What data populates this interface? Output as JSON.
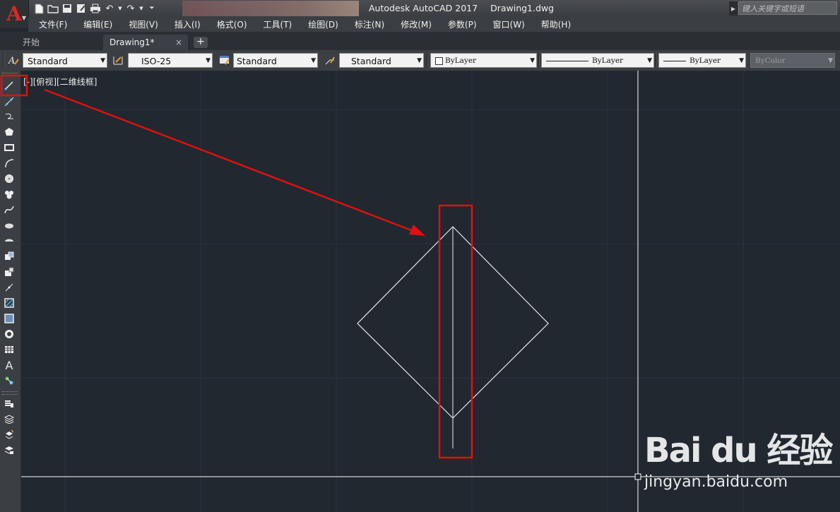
{
  "window": {
    "app_name": "Autodesk AutoCAD 2017",
    "file_name": "Drawing1.dwg",
    "search_placeholder": "键入关键字或短语"
  },
  "menubar": [
    {
      "label": "文件(F)"
    },
    {
      "label": "编辑(E)"
    },
    {
      "label": "视图(V)"
    },
    {
      "label": "插入(I)"
    },
    {
      "label": "格式(O)"
    },
    {
      "label": "工具(T)"
    },
    {
      "label": "绘图(D)"
    },
    {
      "label": "标注(N)"
    },
    {
      "label": "修改(M)"
    },
    {
      "label": "参数(P)"
    },
    {
      "label": "窗口(W)"
    },
    {
      "label": "帮助(H)"
    }
  ],
  "tabs": [
    {
      "label": "开始",
      "active": false
    },
    {
      "label": "Drawing1*",
      "active": true
    }
  ],
  "tab_close": "×",
  "tab_add": "+",
  "toolbar": {
    "text_style": "Standard",
    "dim_style": "ISO-25",
    "table_style": "Standard",
    "multileader_style": "Standard",
    "layer_color": "ByLayer",
    "linetype": "ByLayer",
    "lineweight": "ByLayer",
    "plot_style": "ByColor"
  },
  "viewport": {
    "label": "[-][俯视][二维线框]"
  },
  "watermark": {
    "logo": "Bai du 经验",
    "url": "jingyan.baidu.com"
  },
  "colors": {
    "canvas": "#212830",
    "highlight": "#e01010",
    "drawing_lines": "#e8e8e8",
    "crosshair": "#ffffff",
    "logo_red": "#d62a25"
  }
}
